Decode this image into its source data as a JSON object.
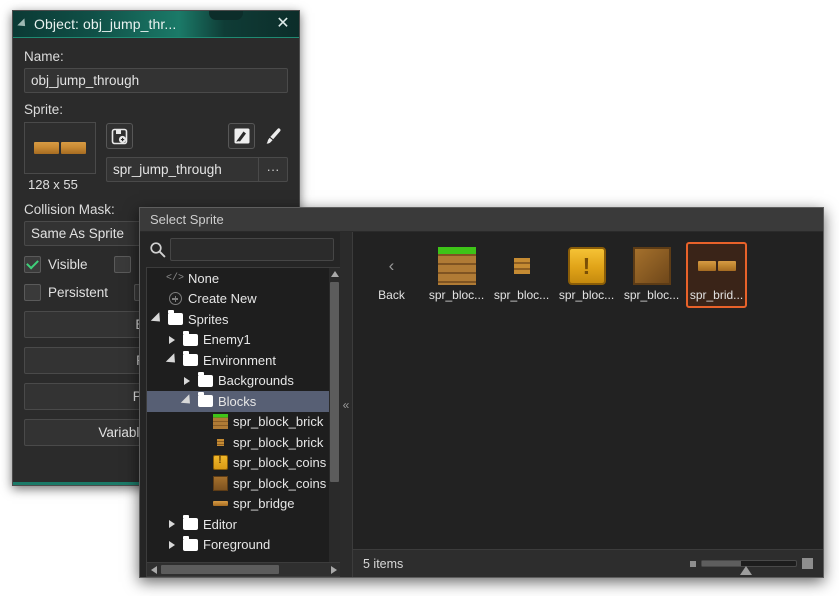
{
  "object_window": {
    "title": "Object: obj_jump_thr...",
    "close_icon": "close-icon",
    "name_label": "Name:",
    "name_value": "obj_jump_through",
    "sprite_label": "Sprite:",
    "sprite_thumb_icon": "bridge-sprite-thumb",
    "sprite_size": "128 x 55",
    "new_sprite_icon": "new-sprite-icon",
    "edit_sprite_icon": "edit-sprite-image-icon",
    "paint_icon": "paint-brush-icon",
    "sprite_name_value": "spr_jump_through",
    "sprite_more_label": "···",
    "collision_label": "Collision Mask:",
    "collision_value": "Same As Sprite",
    "checkbox_visible": {
      "label": "Visible",
      "checked": true
    },
    "checkbox_persistent": {
      "label": "Persistent",
      "checked": false
    },
    "buttons": [
      {
        "label": "Events"
      },
      {
        "label": "Parent"
      },
      {
        "label": "Physics"
      },
      {
        "label": "Variable Definitions"
      }
    ]
  },
  "select_sprite": {
    "title": "Select Sprite",
    "search_icon": "search-icon",
    "search_value": "",
    "splitter_label": "«",
    "tree": [
      {
        "label": "None",
        "icon": "code-none-icon",
        "depth": 0,
        "twisty": "none",
        "selected": false
      },
      {
        "label": "Create New",
        "icon": "plus-circle-icon",
        "depth": 0,
        "twisty": "none",
        "selected": false
      },
      {
        "label": "Sprites",
        "icon": "folder-icon",
        "depth": 0,
        "twisty": "expanded",
        "selected": false
      },
      {
        "label": "Enemy1",
        "icon": "folder-icon",
        "depth": 1,
        "twisty": "collapsed",
        "selected": false
      },
      {
        "label": "Environment",
        "icon": "folder-icon",
        "depth": 1,
        "twisty": "expanded",
        "selected": false
      },
      {
        "label": "Backgrounds",
        "icon": "folder-icon",
        "depth": 2,
        "twisty": "collapsed",
        "selected": false
      },
      {
        "label": "Blocks",
        "icon": "folder-icon",
        "depth": 2,
        "twisty": "expanded",
        "selected": true
      },
      {
        "label": "spr_block_brick",
        "icon": "grass-block-icon",
        "depth": 3,
        "twisty": "none",
        "selected": false
      },
      {
        "label": "spr_block_brick",
        "icon": "brick-debris-icon",
        "depth": 3,
        "twisty": "none",
        "selected": false
      },
      {
        "label": "spr_block_coins",
        "icon": "coin-block-icon",
        "depth": 3,
        "twisty": "none",
        "selected": false
      },
      {
        "label": "spr_block_coins",
        "icon": "wood-block-icon",
        "depth": 3,
        "twisty": "none",
        "selected": false
      },
      {
        "label": "spr_bridge",
        "icon": "bridge-icon",
        "depth": 3,
        "twisty": "none",
        "selected": false
      },
      {
        "label": "Editor",
        "icon": "folder-icon",
        "depth": 1,
        "twisty": "collapsed",
        "selected": false
      },
      {
        "label": "Foreground",
        "icon": "folder-icon",
        "depth": 1,
        "twisty": "collapsed",
        "selected": false
      }
    ],
    "grid": [
      {
        "label": "Back",
        "icon": "back-arrow-icon",
        "selected": false
      },
      {
        "label": "spr_bloc...",
        "icon": "grass-block-icon",
        "selected": false
      },
      {
        "label": "spr_bloc...",
        "icon": "brick-debris-icon",
        "selected": false
      },
      {
        "label": "spr_bloc...",
        "icon": "coin-block-icon",
        "selected": false
      },
      {
        "label": "spr_bloc...",
        "icon": "wood-block-icon",
        "selected": false
      },
      {
        "label": "spr_brid...",
        "icon": "bridge-icon",
        "selected": true
      }
    ],
    "status_text": "5 items",
    "zoom_slider_icon": "zoom-size-slider"
  },
  "colors": {
    "object_title_accent": "#1b7a68",
    "selection_orange": "#e8622a",
    "tree_selection": "#575f74",
    "checkbox_check": "#3fd07a",
    "window_bg": "#2b2b2b",
    "dialog_bg": "#252525"
  }
}
